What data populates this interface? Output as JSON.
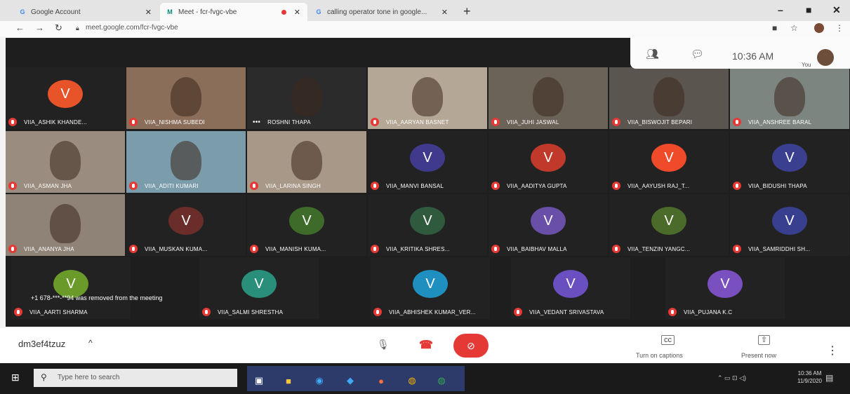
{
  "browser": {
    "tabs": [
      {
        "title": "Google Account",
        "favicon": "G"
      },
      {
        "title": "Meet - fcr-fvgc-vbe",
        "favicon": "M"
      },
      {
        "title": "calling operator tone in google...",
        "favicon": "G"
      }
    ],
    "url": "meet.google.com/fcr-fvgc-vbe"
  },
  "meet": {
    "time": "10:36 AM",
    "you_label": "You",
    "meeting_code": "dm3ef4tzuz",
    "toast": "+1 678-***-**94 was removed from the meeting",
    "captions_label": "Turn on captions",
    "present_label": "Present now",
    "participants": [
      {
        "name": "VIIA_ASHIK KHANDE...",
        "type": "avatar",
        "color": "#e8542a"
      },
      {
        "name": "VIIA_NISHMA SUBEDI",
        "type": "video",
        "color": "#8b6e5a"
      },
      {
        "name": "ROSHNI THAPA",
        "type": "video",
        "color": "#2b2b2b"
      },
      {
        "name": "VIIA_AARYAN BASNET",
        "type": "video",
        "color": "#b5a795"
      },
      {
        "name": "VIIA_JUHI JASWAL",
        "type": "video",
        "color": "#6b6258"
      },
      {
        "name": "VIIA_BISWOJIT BEPARI",
        "type": "video",
        "color": "#5a564f"
      },
      {
        "name": "VIIA_ANSHREE BARAL",
        "type": "video",
        "color": "#7c8580"
      },
      {
        "name": "VIIA_ASMAN JHA",
        "type": "video",
        "color": "#9a8c7e"
      },
      {
        "name": "VIIA_ADITI KUMARI",
        "type": "video",
        "color": "#7a9cab"
      },
      {
        "name": "VIIA_LARINA SINGH",
        "type": "video",
        "color": "#a89888"
      },
      {
        "name": "VIIA_MANVI BANSAL",
        "type": "avatar",
        "color": "#3f3a8c"
      },
      {
        "name": "VIIA_AADITYA GUPTA",
        "type": "avatar",
        "color": "#c0392b"
      },
      {
        "name": "VIIA_AAYUSH RAJ_T...",
        "type": "avatar",
        "color": "#ef4a2a"
      },
      {
        "name": "VIIA_BIDUSHI THAPA",
        "type": "avatar",
        "color": "#3a3f8f"
      },
      {
        "name": "VIIA_ANANYA JHA",
        "type": "video",
        "color": "#8f8276"
      },
      {
        "name": "VIIA_MUSKAN KUMA...",
        "type": "avatar",
        "color": "#6b2d2a"
      },
      {
        "name": "VIIA_MANISH KUMA...",
        "type": "avatar",
        "color": "#3f6b2a"
      },
      {
        "name": "VIIA_KRITIKA SHRES...",
        "type": "avatar",
        "color": "#2f5a3e"
      },
      {
        "name": "VIIA_BAIBHAV MALLA",
        "type": "avatar",
        "color": "#6a4fa8"
      },
      {
        "name": "VIIA_TENZIN YANGC...",
        "type": "avatar",
        "color": "#4a6b2a"
      },
      {
        "name": "VIIA_SAMRIDDHI SH...",
        "type": "avatar",
        "color": "#383f8f"
      },
      {
        "name": "VIIA_AARTI SHARMA",
        "type": "avatar",
        "color": "#6a9a2a"
      },
      {
        "name": "VIIA_SALMI SHRESTHA",
        "type": "avatar",
        "color": "#2a8f7a"
      },
      {
        "name": "VIIA_ABHISHEK KUMAR_VER...",
        "type": "avatar",
        "color": "#1f8fc0"
      },
      {
        "name": "VIIA_VEDANT SRIVASTAVA",
        "type": "avatar",
        "color": "#6a4fc0"
      },
      {
        "name": "VIIA_PUJANA K.C",
        "type": "avatar",
        "color": "#7a4fc0"
      }
    ]
  },
  "taskbar": {
    "search_placeholder": "Type here to search",
    "time": "10:36 AM",
    "date": "11/9/2020"
  },
  "icons": [
    "close-icon",
    "plus-icon",
    "back-icon",
    "forward-icon",
    "reload-icon",
    "lock-icon",
    "star-icon",
    "people-icon",
    "chat-icon",
    "mic-icon",
    "hangup-icon",
    "camera-off-icon",
    "captions-icon",
    "present-icon",
    "more-icon",
    "windows-icon",
    "search-icon"
  ]
}
